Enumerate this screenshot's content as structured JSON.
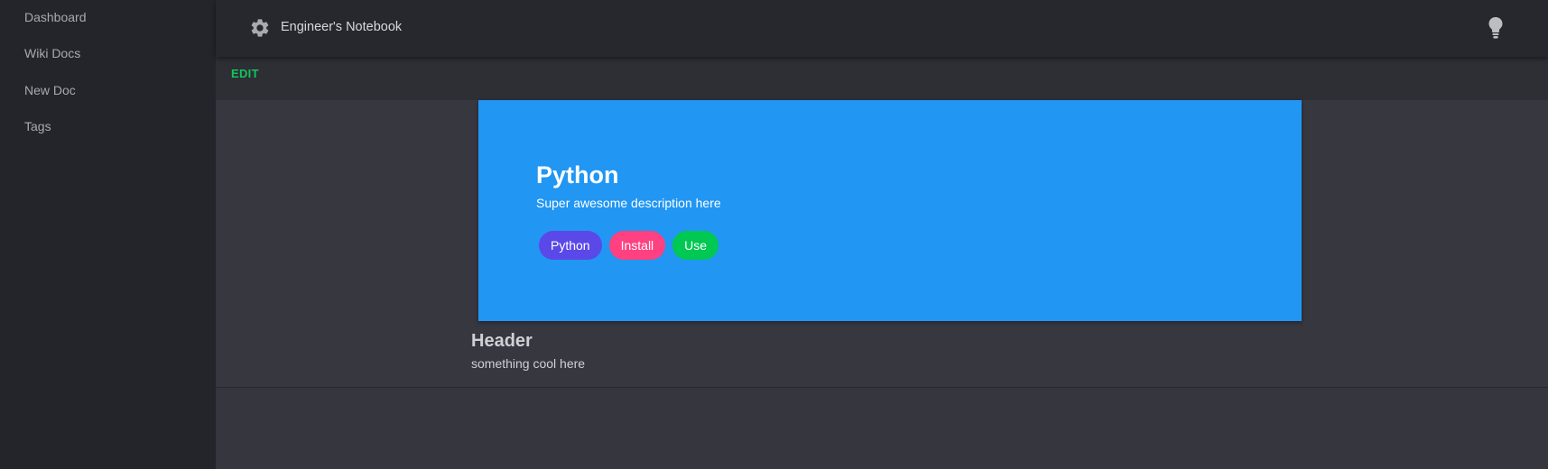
{
  "sidebar": {
    "items": [
      {
        "label": "Dashboard"
      },
      {
        "label": "Wiki Docs"
      },
      {
        "label": "New Doc"
      },
      {
        "label": "Tags"
      }
    ]
  },
  "topbar": {
    "title": "Engineer's Notebook",
    "settings_icon": "gear-icon",
    "theme_icon": "lightbulb-icon"
  },
  "editbar": {
    "edit_label": "EDIT"
  },
  "hero": {
    "title": "Python",
    "description": "Super awesome description here",
    "background": "#2196f3",
    "tags": [
      {
        "label": "Python",
        "color": "#5b48e8"
      },
      {
        "label": "Install",
        "color": "#ff4081"
      },
      {
        "label": "Use",
        "color": "#00c853"
      }
    ]
  },
  "section": {
    "title": "Header",
    "text": "something cool here"
  },
  "colors": {
    "accent": "#13c45c",
    "sidebar_bg": "#24242b",
    "topbar_bg": "#27272e",
    "content_bg": "#373740"
  }
}
